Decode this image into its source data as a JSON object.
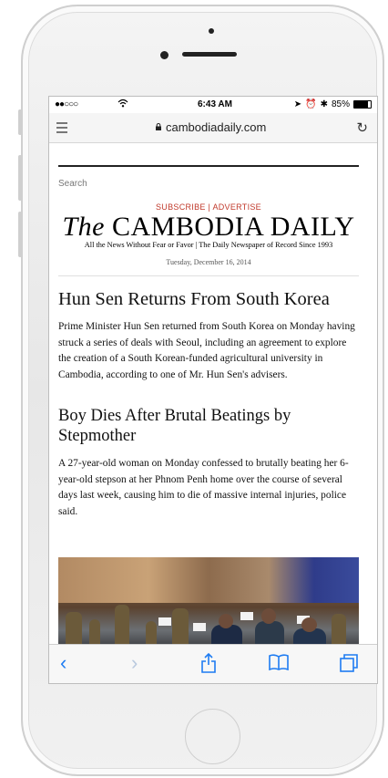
{
  "status": {
    "carrier": "●●○○○",
    "time": "6:43 AM",
    "battery": "85%"
  },
  "browser": {
    "url": "cambodiadaily.com"
  },
  "page": {
    "search_placeholder": "Search",
    "subscribe": "SUBSCRIBE | ADVERTISE",
    "masthead_the": "The",
    "masthead_name": "CAMBODIA DAILY",
    "tagline": "All the News Without Fear or Favor | The Daily Newspaper of Record Since 1993",
    "date": "Tuesday, December 16, 2014"
  },
  "articles": [
    {
      "title": "Hun Sen Returns From South Korea",
      "summary": "Prime Minister Hun Sen returned from South Korea on Monday having struck a series of deals with Seoul, including an agreement to explore the creation of a South Korean-funded agricultural university in Cambodia, according to one of Mr. Hun Sen's advisers."
    },
    {
      "title": "Boy Dies After Brutal Beatings by Stepmother",
      "summary": "A 27-year-old woman on Monday confessed to brutally beating her 6-year-old stepson at her Phnom Penh home over the course of several days last week, causing him to die of massive internal injuries, police said."
    }
  ],
  "toolbar": {
    "back": "‹",
    "forward": "›",
    "share": "⇧",
    "bookmarks": "📖",
    "tabs": "❐"
  }
}
